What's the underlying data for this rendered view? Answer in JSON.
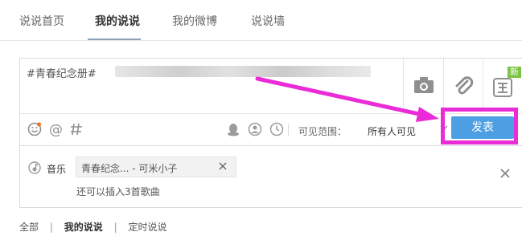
{
  "tabs": [
    {
      "label": "说说首页",
      "active": false
    },
    {
      "label": "我的说说",
      "active": true
    },
    {
      "label": "我的微博",
      "active": false
    },
    {
      "label": "说说墙",
      "active": false
    }
  ],
  "composer": {
    "hashtag_text": "#青春纪念册#",
    "media": {
      "photo_icon": "camera-icon",
      "link_icon": "paperclip-icon",
      "fun_icon": "fun-icon",
      "fun_badge": "新"
    },
    "toolbar": {
      "emoji_icon": "emoji-icon",
      "mention_icon": "at-icon",
      "topic_icon": "hash-icon",
      "visibility_label": "可见范围：",
      "visibility_value": "所有人可见"
    },
    "post_button": "发表"
  },
  "music": {
    "label": "音乐",
    "selected_song": "青春纪念... - 可米小子",
    "hint": "还可以插入3首歌曲"
  },
  "filters": {
    "all": "全部",
    "mine": "我的说说",
    "scheduled": "定时说说",
    "separator": "|"
  },
  "colors": {
    "accent_button": "#4d9fe3",
    "highlight": "#ea2bd8",
    "new_badge": "#7cc243"
  }
}
